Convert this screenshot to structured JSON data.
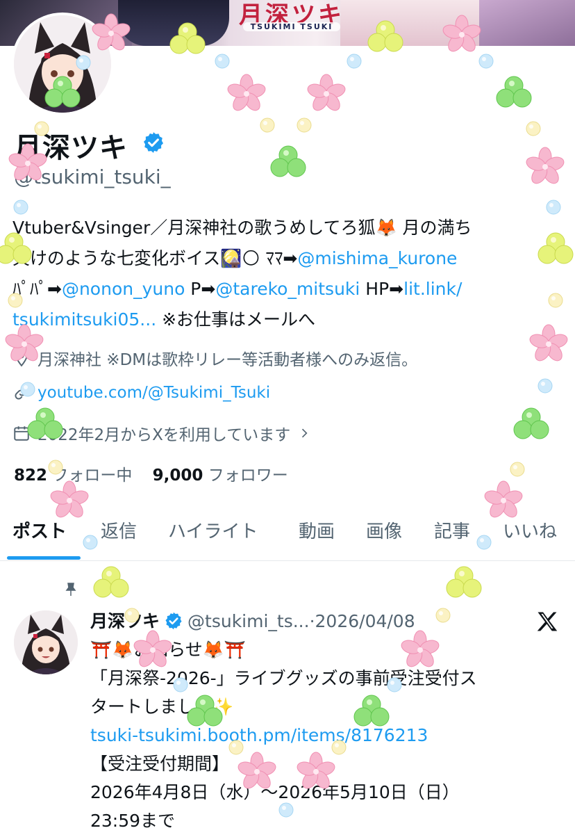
{
  "banner": {
    "logo_text": "月深ツキ",
    "logo_sub": "TSUKIMI TSUKI"
  },
  "profile": {
    "display_name": "月深ツキ",
    "handle": "@tsukimi_tsuki_",
    "bio": {
      "line1": "Vtuber&Vsinger／月深神社の歌うめしてろ狐🦊 月の満ち",
      "line2_prefix": "欠けのような七変化ボイス🎑🌕 ﾏﾏ➡",
      "mama_link": "@mishima_kurone",
      "line3_prefix": "ﾊﾟﾊﾟ➡",
      "papa_link": "@nonon_yuno",
      "p_prefix": " P➡",
      "p_link": "@tareko_mitsuki",
      "hp_prefix": " HP➡",
      "hp_link_1": "lit.link/",
      "hp_link_2": "tsukimitsuki05...",
      "line4_suffix": " ※お仕事はメールへ"
    },
    "location": "月深神社 ※DMは歌枠リレー等活動者様へのみ返信。",
    "website": "youtube.com/@Tsukimi_Tsuki",
    "joined": "2022年2月からXを利用しています",
    "following_count": "822",
    "following_label": "フォロー中",
    "followers_count": "9,000",
    "followers_label": "フォロワー"
  },
  "tabs": [
    "ポスト",
    "返信",
    "ハイライト",
    "動画",
    "画像",
    "記事",
    "いいね"
  ],
  "pinned_post": {
    "author_name": "月深ツキ",
    "author_handle": "@tsukimi_ts...",
    "separator": "·",
    "date": "2026/04/08",
    "line1": "⛩️🦊お知らせ🦊⛩️",
    "line2": "「月深祭-2026-」ライブグッズの事前受注受付ス",
    "line3": "タートしました✨",
    "link": "tsuki-tsukimi.booth.pm/items/8176213",
    "line5": "【受注受付期間】",
    "line6": "2026年4月8日（水）～2026年5月10日（日）",
    "line7": "23:59まで"
  },
  "colors": {
    "accent": "#1d9bf0",
    "text": "#0f1419",
    "muted": "#536471"
  }
}
